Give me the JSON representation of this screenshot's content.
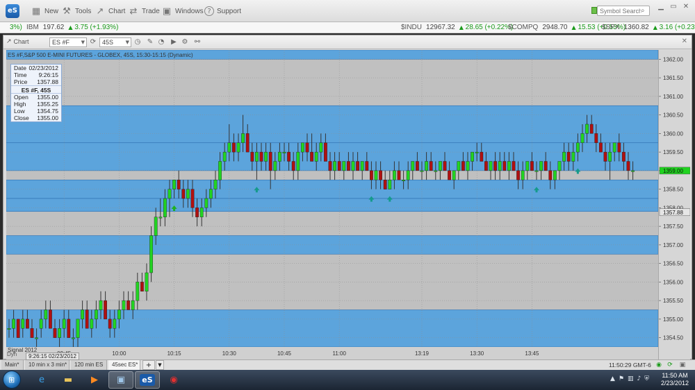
{
  "menu": {
    "logo": "eS",
    "items": [
      {
        "id": "new",
        "label": "New",
        "icon": "▦"
      },
      {
        "id": "tools",
        "label": "Tools",
        "icon": "⚒"
      },
      {
        "id": "chart",
        "label": "Chart",
        "icon": "↗"
      },
      {
        "id": "trade",
        "label": "Trade",
        "icon": "⇄"
      },
      {
        "id": "windows",
        "label": "Windows",
        "icon": "▣"
      },
      {
        "id": "support",
        "label": "Support",
        "icon": "?"
      }
    ],
    "search_placeholder": "Symbol Search"
  },
  "ticker": [
    {
      "symbol": "",
      "price": "",
      "change": "3%)",
      "pos": 2
    },
    {
      "symbol": "IBM",
      "price": "197.62",
      "change": "3.75 (+1.93%)",
      "pos": 38,
      "arrow": true
    },
    {
      "symbol": "$INDU",
      "price": "12967.32",
      "change": "28.65 (+0.22%)",
      "pos": 577,
      "arrow": true
    },
    {
      "symbol": "$COMPQ",
      "price": "2948.70",
      "change": "15.53 (+0.53%)",
      "pos": 731,
      "arrow": true
    },
    {
      "symbol": "$SPX",
      "price": "1360.82",
      "change": "3.16 (+0.23%)",
      "pos": 866,
      "arrow": true
    }
  ],
  "chart_toolbar": {
    "title": "Chart",
    "symbol": "ES #F",
    "interval": "45S"
  },
  "chart_header": "ES #F,S&P 500 E-MINI FUTURES - GLOBEX, 45S, 15:30-15:15 (Dynamic)",
  "data_window": {
    "rows_top": [
      {
        "k": "Date",
        "v": "02/23/2012"
      },
      {
        "k": "Time",
        "v": "9:26:15"
      },
      {
        "k": "Price",
        "v": "1357.88"
      }
    ],
    "head": "ES #F, 45S",
    "rows_bottom": [
      {
        "k": "Open",
        "v": "1355.00"
      },
      {
        "k": "High",
        "v": "1355.25"
      },
      {
        "k": "Low",
        "v": "1354.75"
      },
      {
        "k": "Close",
        "v": "1355.00"
      }
    ]
  },
  "corner_readout": "Signal 2012",
  "corner_time": "9:26:15 02/23/2012",
  "dyn_label": "Dyn",
  "price_tags": {
    "last": "1359.00",
    "cursor": "1357.88",
    "last_color": "#1fd31f",
    "cursor_color": "#e6e6e6"
  },
  "colors": {
    "up": "#22d422",
    "down": "#b01010",
    "band": "#4a9fe0",
    "chart_bg": "#c0c0c0",
    "arrow": "#159a8c",
    "arrow_green": "#20b020"
  },
  "chart_data": {
    "type": "candlestick",
    "title": "ES #F,S&P 500 E-MINI FUTURES - GLOBEX, 45S, 15:30-15:15 (Dynamic)",
    "ylim": [
      1354.25,
      1362.25
    ],
    "y_ticks": [
      "1362.00",
      "1361.50",
      "1361.00",
      "1360.50",
      "1360.00",
      "1359.50",
      "1359.00",
      "1358.50",
      "1358.00",
      "1357.50",
      "1357.00",
      "1356.50",
      "1356.00",
      "1355.50",
      "1355.00",
      "1354.50"
    ],
    "x_ticks": [
      "09:45",
      "10:00",
      "10:15",
      "10:30",
      "10:45",
      "11:00",
      "13:19",
      "13:30",
      "13:45"
    ],
    "bands": [
      [
        1362.25,
        1362.0
      ],
      [
        1360.75,
        1359.75
      ],
      [
        1359.75,
        1359.0
      ],
      [
        1358.75,
        1358.25
      ],
      [
        1358.25,
        1357.9
      ],
      [
        1357.25,
        1356.75
      ],
      [
        1355.25,
        1354.25
      ]
    ],
    "candles": [
      [
        1354.75,
        1355.0,
        1354.5,
        1354.75
      ],
      [
        1354.75,
        1355.25,
        1354.5,
        1355.0
      ],
      [
        1355.0,
        1355.0,
        1354.5,
        1354.5
      ],
      [
        1354.75,
        1355.25,
        1354.5,
        1355.0
      ],
      [
        1355.0,
        1355.25,
        1354.75,
        1354.75
      ],
      [
        1354.75,
        1355.0,
        1354.5,
        1354.5
      ],
      [
        1354.5,
        1354.75,
        1354.25,
        1354.5
      ],
      [
        1354.75,
        1355.25,
        1354.5,
        1355.0
      ],
      [
        1355.0,
        1355.5,
        1354.75,
        1355.25
      ],
      [
        1355.25,
        1355.5,
        1354.75,
        1354.75
      ],
      [
        1354.75,
        1355.0,
        1354.5,
        1354.5
      ],
      [
        1354.5,
        1355.0,
        1354.25,
        1354.75
      ],
      [
        1354.75,
        1355.25,
        1354.5,
        1355.0
      ],
      [
        1355.0,
        1355.25,
        1354.5,
        1354.5
      ],
      [
        1354.5,
        1354.75,
        1354.25,
        1354.5
      ],
      [
        1354.5,
        1355.0,
        1354.25,
        1355.0
      ],
      [
        1355.0,
        1355.5,
        1354.75,
        1355.25
      ],
      [
        1355.25,
        1355.5,
        1354.75,
        1354.75
      ],
      [
        1354.75,
        1355.25,
        1354.5,
        1355.0
      ],
      [
        1355.0,
        1355.5,
        1354.75,
        1355.25
      ],
      [
        1355.25,
        1355.75,
        1355.0,
        1355.5
      ],
      [
        1355.5,
        1355.75,
        1355.0,
        1355.0
      ],
      [
        1355.0,
        1355.25,
        1354.5,
        1354.75
      ],
      [
        1354.75,
        1355.25,
        1354.5,
        1355.0
      ],
      [
        1355.0,
        1355.5,
        1354.75,
        1355.25
      ],
      [
        1355.25,
        1355.75,
        1355.0,
        1355.5
      ],
      [
        1355.5,
        1355.75,
        1355.25,
        1355.25
      ],
      [
        1355.25,
        1355.75,
        1355.0,
        1355.5
      ],
      [
        1355.5,
        1356.25,
        1355.25,
        1356.0
      ],
      [
        1356.0,
        1356.25,
        1355.75,
        1355.75
      ],
      [
        1355.75,
        1356.5,
        1355.5,
        1356.25
      ],
      [
        1356.25,
        1357.5,
        1356.0,
        1357.25
      ],
      [
        1357.25,
        1358.0,
        1357.0,
        1357.75
      ],
      [
        1357.75,
        1358.25,
        1357.5,
        1357.75
      ],
      [
        1357.75,
        1358.5,
        1357.5,
        1358.25
      ],
      [
        1358.25,
        1358.75,
        1357.75,
        1358.5
      ],
      [
        1358.5,
        1358.75,
        1358.25,
        1358.75
      ],
      [
        1358.75,
        1359.0,
        1358.25,
        1358.5
      ],
      [
        1358.5,
        1358.75,
        1358.0,
        1358.25
      ],
      [
        1358.25,
        1358.75,
        1358.0,
        1358.5
      ],
      [
        1358.5,
        1358.75,
        1357.75,
        1358.0
      ],
      [
        1358.0,
        1358.25,
        1357.5,
        1357.75
      ],
      [
        1357.75,
        1358.25,
        1357.5,
        1358.0
      ],
      [
        1358.0,
        1358.5,
        1357.75,
        1358.25
      ],
      [
        1358.25,
        1358.75,
        1358.0,
        1358.5
      ],
      [
        1358.5,
        1359.0,
        1358.25,
        1358.75
      ],
      [
        1358.75,
        1359.5,
        1358.5,
        1359.25
      ],
      [
        1359.25,
        1359.75,
        1359.0,
        1359.5
      ],
      [
        1359.5,
        1360.25,
        1359.25,
        1359.75
      ],
      [
        1359.75,
        1360.0,
        1359.25,
        1359.5
      ],
      [
        1359.5,
        1360.0,
        1359.25,
        1359.75
      ],
      [
        1359.75,
        1360.5,
        1359.5,
        1360.0
      ],
      [
        1360.0,
        1360.25,
        1359.5,
        1359.5
      ],
      [
        1359.5,
        1359.75,
        1359.0,
        1359.25
      ],
      [
        1359.25,
        1359.75,
        1358.75,
        1359.5
      ],
      [
        1359.5,
        1359.75,
        1359.0,
        1359.25
      ],
      [
        1359.25,
        1359.75,
        1359.0,
        1359.5
      ],
      [
        1359.5,
        1359.75,
        1358.5,
        1359.0
      ],
      [
        1359.0,
        1359.5,
        1358.75,
        1359.25
      ],
      [
        1359.25,
        1359.75,
        1359.0,
        1359.5
      ],
      [
        1359.5,
        1359.75,
        1359.25,
        1359.5
      ],
      [
        1359.5,
        1359.75,
        1359.0,
        1359.25
      ],
      [
        1359.25,
        1359.5,
        1358.75,
        1359.0
      ],
      [
        1359.0,
        1359.75,
        1358.75,
        1359.5
      ],
      [
        1359.5,
        1359.75,
        1359.25,
        1359.75
      ],
      [
        1359.75,
        1360.0,
        1359.25,
        1359.5
      ],
      [
        1359.5,
        1360.0,
        1359.25,
        1359.25
      ],
      [
        1359.25,
        1359.75,
        1359.0,
        1359.5
      ],
      [
        1359.5,
        1360.0,
        1359.25,
        1359.75
      ],
      [
        1359.75,
        1360.0,
        1359.25,
        1359.25
      ],
      [
        1359.25,
        1359.5,
        1358.75,
        1359.0
      ],
      [
        1359.0,
        1359.5,
        1358.75,
        1359.25
      ],
      [
        1359.25,
        1359.5,
        1359.0,
        1359.0
      ],
      [
        1359.0,
        1359.25,
        1358.75,
        1359.25
      ],
      [
        1359.25,
        1359.5,
        1359.0,
        1359.0
      ],
      [
        1359.0,
        1359.5,
        1358.75,
        1359.25
      ],
      [
        1359.25,
        1359.5,
        1359.0,
        1359.0
      ],
      [
        1359.0,
        1359.25,
        1358.75,
        1359.25
      ],
      [
        1359.25,
        1359.5,
        1359.0,
        1359.0
      ],
      [
        1359.0,
        1359.25,
        1358.5,
        1358.75
      ],
      [
        1358.75,
        1359.25,
        1358.5,
        1359.0
      ],
      [
        1359.0,
        1359.25,
        1358.5,
        1358.75
      ],
      [
        1358.75,
        1359.0,
        1358.5,
        1358.5
      ],
      [
        1358.5,
        1359.0,
        1358.5,
        1358.75
      ],
      [
        1358.75,
        1359.25,
        1358.5,
        1359.0
      ],
      [
        1359.0,
        1359.25,
        1358.75,
        1358.75
      ],
      [
        1358.75,
        1359.0,
        1358.5,
        1358.75
      ],
      [
        1358.75,
        1359.25,
        1358.5,
        1359.0
      ],
      [
        1359.0,
        1359.25,
        1358.75,
        1359.25
      ],
      [
        1359.25,
        1359.5,
        1359.0,
        1359.0
      ],
      [
        1359.0,
        1359.25,
        1358.75,
        1359.0
      ],
      [
        1359.0,
        1359.5,
        1358.75,
        1359.25
      ],
      [
        1359.25,
        1359.5,
        1359.0,
        1359.0
      ],
      [
        1359.0,
        1359.25,
        1358.75,
        1359.0
      ],
      [
        1359.0,
        1359.25,
        1358.75,
        1359.25
      ],
      [
        1359.25,
        1359.5,
        1359.0,
        1359.0
      ],
      [
        1359.0,
        1359.25,
        1358.75,
        1358.75
      ],
      [
        1358.75,
        1359.0,
        1358.5,
        1359.0
      ],
      [
        1359.0,
        1359.25,
        1358.75,
        1359.25
      ],
      [
        1359.25,
        1359.5,
        1359.0,
        1359.0
      ],
      [
        1359.0,
        1359.5,
        1358.75,
        1359.25
      ],
      [
        1359.25,
        1359.5,
        1359.0,
        1359.5
      ],
      [
        1359.5,
        1359.75,
        1359.25,
        1359.5
      ],
      [
        1359.5,
        1359.75,
        1359.25,
        1359.25
      ],
      [
        1359.25,
        1359.5,
        1359.0,
        1359.0
      ],
      [
        1359.0,
        1359.25,
        1358.75,
        1359.25
      ],
      [
        1359.25,
        1359.5,
        1358.75,
        1359.0
      ],
      [
        1359.0,
        1359.5,
        1358.75,
        1359.25
      ],
      [
        1359.25,
        1359.5,
        1359.0,
        1359.0
      ],
      [
        1359.0,
        1359.5,
        1358.75,
        1359.25
      ],
      [
        1359.25,
        1359.5,
        1359.0,
        1359.0
      ],
      [
        1359.0,
        1359.25,
        1358.5,
        1358.75
      ],
      [
        1358.75,
        1359.25,
        1358.5,
        1359.0
      ],
      [
        1359.0,
        1359.25,
        1358.75,
        1359.25
      ],
      [
        1359.25,
        1359.5,
        1359.0,
        1359.0
      ],
      [
        1359.0,
        1359.25,
        1358.75,
        1359.0
      ],
      [
        1359.0,
        1359.25,
        1358.75,
        1359.25
      ],
      [
        1359.25,
        1359.5,
        1359.0,
        1359.0
      ],
      [
        1359.0,
        1359.25,
        1358.5,
        1358.75
      ],
      [
        1358.75,
        1359.0,
        1358.5,
        1359.0
      ],
      [
        1359.0,
        1359.25,
        1358.75,
        1359.25
      ],
      [
        1359.25,
        1359.75,
        1359.0,
        1359.5
      ],
      [
        1359.5,
        1359.75,
        1359.0,
        1359.25
      ],
      [
        1359.25,
        1359.75,
        1359.0,
        1359.5
      ],
      [
        1359.5,
        1360.0,
        1359.25,
        1359.75
      ],
      [
        1359.75,
        1360.25,
        1359.5,
        1360.0
      ],
      [
        1360.0,
        1360.5,
        1359.75,
        1360.25
      ],
      [
        1360.25,
        1360.5,
        1360.0,
        1360.0
      ],
      [
        1360.0,
        1360.25,
        1359.5,
        1359.75
      ],
      [
        1359.75,
        1360.0,
        1359.5,
        1359.5
      ],
      [
        1359.5,
        1359.75,
        1359.0,
        1359.25
      ],
      [
        1359.25,
        1359.75,
        1358.75,
        1359.5
      ],
      [
        1359.5,
        1359.75,
        1359.25,
        1359.75
      ],
      [
        1359.75,
        1360.0,
        1359.25,
        1359.5
      ],
      [
        1359.5,
        1359.75,
        1359.0,
        1359.25
      ],
      [
        1359.25,
        1359.5,
        1358.75,
        1359.0
      ],
      [
        1359.0,
        1359.25,
        1358.75,
        1359.0
      ]
    ],
    "arrow_indices": [
      36,
      54,
      79,
      83,
      115,
      124
    ],
    "x_tick_indices": [
      12,
      24,
      36,
      48,
      60,
      72,
      90,
      102,
      114
    ]
  },
  "tabs": [
    {
      "label": "Main*",
      "left": 2,
      "width": 32
    },
    {
      "label": "10 min x 3 min*",
      "left": 36,
      "width": 64
    },
    {
      "label": "120 min ES",
      "left": 102,
      "width": 52
    },
    {
      "label": "45sec ES*",
      "left": 156,
      "width": 46,
      "active": true
    }
  ],
  "status": {
    "time": "11:50:29 GMT-6"
  },
  "taskbar": {
    "clock_time": "11:50 AM",
    "clock_date": "2/23/2012",
    "apps": [
      {
        "id": "ie",
        "glyph": "e",
        "color": "#3aa0e8",
        "left": 42
      },
      {
        "id": "explorer",
        "glyph": "▬",
        "color": "#e9c45a",
        "left": 80
      },
      {
        "id": "media",
        "glyph": "▶",
        "color": "#ff8a20",
        "left": 118
      },
      {
        "id": "computer",
        "glyph": "▣",
        "color": "#9fc6e8",
        "left": 156,
        "active": true
      },
      {
        "id": "esignal",
        "glyph": "eS",
        "color": "#ffffff",
        "left": 194,
        "active": true
      },
      {
        "id": "other",
        "glyph": "◉",
        "color": "#e03030",
        "left": 232
      }
    ]
  }
}
